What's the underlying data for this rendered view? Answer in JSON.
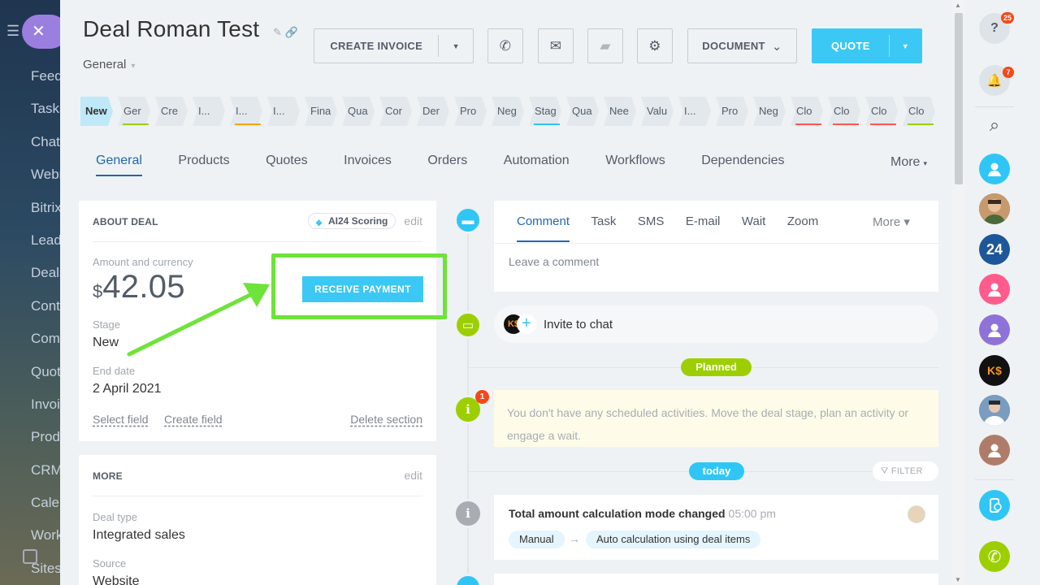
{
  "background_menu": {
    "items": [
      "Feed",
      "Tasks",
      "Chat",
      "Webm",
      "Bitrix",
      "Leads",
      "Deals",
      "Conta",
      "Comp",
      "Quote",
      "Invoic",
      "Produ",
      "CRM",
      "Calen",
      "Works",
      "Sites"
    ],
    "close_glyph": "✕",
    "hamburger_glyph": "☰"
  },
  "header": {
    "title": "Deal Roman  Test",
    "title_icons": "✎ 🔗",
    "category": "General",
    "category_caret": "▾"
  },
  "toolbar": {
    "create_invoice": "CREATE INVOICE",
    "dropdown_glyph": "▼",
    "call_icon": "✆",
    "mail_icon": "✉",
    "chat_icon": "▰",
    "gear_icon": "⚙",
    "document": "DOCUMENT",
    "document_caret": "⌄",
    "quote": "QUOTE"
  },
  "stages": [
    {
      "label": "New",
      "bar_color": ""
    },
    {
      "label": "Ger",
      "bar_color": "#9dcf00"
    },
    {
      "label": "Cre",
      "bar_color": ""
    },
    {
      "label": "I...",
      "bar_color": ""
    },
    {
      "label": "I...",
      "bar_color": "#f7a700"
    },
    {
      "label": "I...",
      "bar_color": ""
    },
    {
      "label": "Fina",
      "bar_color": ""
    },
    {
      "label": "Qua",
      "bar_color": ""
    },
    {
      "label": "Cor",
      "bar_color": ""
    },
    {
      "label": "Der",
      "bar_color": ""
    },
    {
      "label": "Pro",
      "bar_color": ""
    },
    {
      "label": "Neg",
      "bar_color": ""
    },
    {
      "label": "Stag",
      "bar_color": "#2fc6f6"
    },
    {
      "label": "Qua",
      "bar_color": ""
    },
    {
      "label": "Nee",
      "bar_color": ""
    },
    {
      "label": "Valu",
      "bar_color": ""
    },
    {
      "label": "I...",
      "bar_color": ""
    },
    {
      "label": "Pro",
      "bar_color": ""
    },
    {
      "label": "Neg",
      "bar_color": ""
    },
    {
      "label": "Clo",
      "bar_color": "#ff5752"
    },
    {
      "label": "Clo",
      "bar_color": "#ff5752"
    },
    {
      "label": "Clo",
      "bar_color": "#ff5752"
    },
    {
      "label": "Clo",
      "bar_color": "#9dcf00"
    }
  ],
  "tabs": {
    "items": [
      "General",
      "Products",
      "Quotes",
      "Invoices",
      "Orders",
      "Automation",
      "Workflows",
      "Dependencies"
    ],
    "more": "More",
    "more_caret": "▾"
  },
  "about": {
    "heading": "ABOUT DEAL",
    "ai_scoring": "AI24 Scoring",
    "ai_icon": "❖",
    "edit": "edit",
    "amount_label": "Amount and currency",
    "currency": "$",
    "amount": "42.05",
    "receive_payment": "RECEIVE PAYMENT",
    "stage_label": "Stage",
    "stage_value": "New",
    "end_date_label": "End date",
    "end_date_value": "2 April 2021",
    "select_field": "Select field",
    "create_field": "Create field",
    "delete_section": "Delete section"
  },
  "more_card": {
    "heading": "MORE",
    "edit": "edit",
    "deal_type_label": "Deal type",
    "deal_type_value": "Integrated sales",
    "source_label": "Source",
    "source_value": "Website"
  },
  "timeline": {
    "editor_tabs": [
      "Comment",
      "Task",
      "SMS",
      "E-mail",
      "Wait",
      "Zoom"
    ],
    "editor_more": "More ▾",
    "comment_placeholder": "Leave a comment",
    "invite": "Invite to chat",
    "chat_avatar": "K$",
    "plus": "+",
    "planned": "Planned",
    "notice_badge": "1",
    "notice": "You don't have any scheduled activities. Move the deal stage, plan an activity or engage a wait.",
    "today": "today",
    "filter": "⛛ FILTER",
    "info_glyph": "i",
    "comment_glyph": "▬",
    "chat_glyph": "▭",
    "history_title": "Total amount calculation mode changed",
    "history_time": "05:00 pm",
    "tag_from": "Manual",
    "tag_arrow": "→",
    "tag_to": "Auto calculation using deal items"
  },
  "right_panel": {
    "help_badge": "25",
    "help_glyph": "?",
    "bell_badge": "7",
    "bell_glyph": "🔔",
    "search_glyph": "⌕",
    "b24_label": "24",
    "ks_label": "K$",
    "phone_glyph": "✆",
    "colors": {
      "blue": "#2fc6f6",
      "navy": "#1e5799",
      "pink": "#ff5c8d",
      "purple": "#8e72d8",
      "brown": "#b07c6a",
      "green": "#9dcf00",
      "cyan": "#2fc6f6"
    }
  },
  "scrollbar": {
    "up": "▲",
    "down": "▼"
  }
}
